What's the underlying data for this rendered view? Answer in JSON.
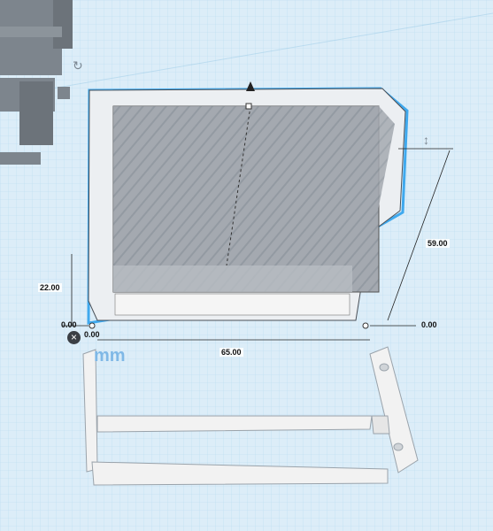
{
  "workplane": {
    "grid_color": "#9fcbe6",
    "background": "#d9ecf8"
  },
  "dimensions": {
    "height_top": "59.00",
    "height_left": "22.00",
    "width_bottom": "65.00",
    "origin_x": "0.00",
    "origin_y": "0.00",
    "right_offset": "0.00"
  },
  "ruler": {
    "unit_label": "mm"
  },
  "controls": {
    "delete_icon": "close-icon",
    "rotate_icon": "rotate-arrow-icon"
  },
  "colors": {
    "selection_outline": "#3fa9ee",
    "selected_fill": "#9aa0a8",
    "part_fill": "#f4f4f4"
  }
}
